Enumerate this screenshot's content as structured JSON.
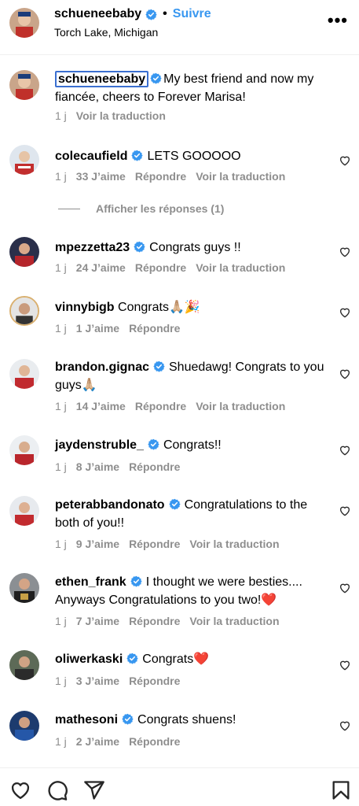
{
  "header": {
    "username": "schueneebaby",
    "dot": "•",
    "follow_label": "Suivre",
    "location": "Torch Lake, Michigan",
    "more_label": "•••"
  },
  "caption": {
    "username": "schueneebaby",
    "text": "My best friend and now my fiancée, cheers to Forever Marisa!",
    "time": "1 j",
    "translate": "Voir la traduction"
  },
  "replies_toggle": "Afficher les réponses (1)",
  "comments": [
    {
      "username": "colecaufield",
      "text": "LETS GOOOOO",
      "time": "1 j",
      "likes": "33 J’aime",
      "reply": "Répondre",
      "translate": "Voir la traduction"
    },
    {
      "username": "mpezzetta23",
      "text": "Congrats guys !!",
      "time": "1 j",
      "likes": "24 J’aime",
      "reply": "Répondre",
      "translate": "Voir la traduction"
    },
    {
      "username": "vinnybigb",
      "text": "Congrats🙏🏼🎉",
      "time": "1 j",
      "likes": "1 J’aime",
      "reply": "Répondre",
      "translate": ""
    },
    {
      "username": "brandon.gignac",
      "text": "Shuedawg! Congrats to you guys🙏🏼",
      "time": "1 j",
      "likes": "14 J’aime",
      "reply": "Répondre",
      "translate": "Voir la traduction"
    },
    {
      "username": "jaydenstruble_",
      "text": "Congrats!!",
      "time": "1 j",
      "likes": "8 J’aime",
      "reply": "Répondre",
      "translate": ""
    },
    {
      "username": "peterabbandonato",
      "text": "Congratulations to the both of you!!",
      "time": "1 j",
      "likes": "9 J’aime",
      "reply": "Répondre",
      "translate": "Voir la traduction"
    },
    {
      "username": "ethen_frank",
      "text": "I thought we were besties.... Anyways Congratulations to you two!❤️",
      "time": "1 j",
      "likes": "7 J’aime",
      "reply": "Répondre",
      "translate": "Voir la traduction"
    },
    {
      "username": "oliwerkaski",
      "text": "Congrats❤️",
      "time": "1 j",
      "likes": "3 J’aime",
      "reply": "Répondre",
      "translate": ""
    },
    {
      "username": "mathesoni",
      "text": "Congrats shuens!",
      "time": "1 j",
      "likes": "2 J’aime",
      "reply": "Répondre",
      "translate": ""
    }
  ],
  "colors": {
    "accent": "#3897f0",
    "muted": "#8e8e8e",
    "verified": "#3897f0",
    "highlight_border": "#3b6fd0"
  }
}
